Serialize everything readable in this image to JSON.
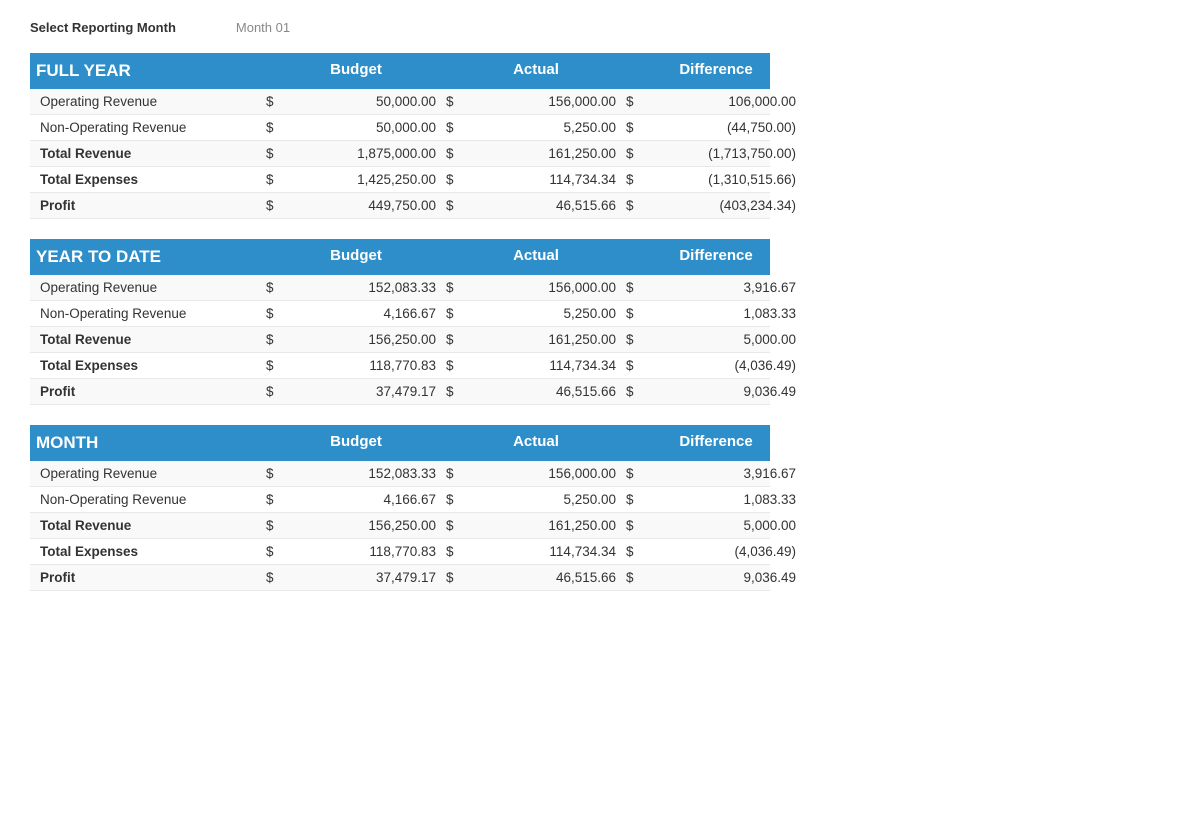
{
  "reporting": {
    "label": "Select Reporting Month",
    "value": "Month 01"
  },
  "sections": [
    {
      "id": "full-year",
      "title": "FULL YEAR",
      "columns": [
        "Budget",
        "Actual",
        "Difference"
      ],
      "rows": [
        {
          "label": " Operating Revenue",
          "bold": false,
          "budget_sign": "$",
          "budget": "50,000.00",
          "actual_sign": "$",
          "actual": "156,000.00",
          "diff_sign": "$",
          "diff": "106,000.00"
        },
        {
          "label": " Non-Operating Revenue",
          "bold": false,
          "budget_sign": "$",
          "budget": "50,000.00",
          "actual_sign": "$",
          "actual": "5,250.00",
          "diff_sign": "$",
          "diff": "(44,750.00)"
        },
        {
          "label": "Total Revenue",
          "bold": true,
          "budget_sign": "$",
          "budget": "1,875,000.00",
          "actual_sign": "$",
          "actual": "161,250.00",
          "diff_sign": "$",
          "diff": "(1,713,750.00)"
        },
        {
          "label": "Total Expenses",
          "bold": true,
          "budget_sign": "$",
          "budget": "1,425,250.00",
          "actual_sign": "$",
          "actual": "114,734.34",
          "diff_sign": "$",
          "diff": "(1,310,515.66)"
        },
        {
          "label": "Profit",
          "bold": true,
          "budget_sign": "$",
          "budget": "449,750.00",
          "actual_sign": "$",
          "actual": "46,515.66",
          "diff_sign": "$",
          "diff": "(403,234.34)"
        }
      ]
    },
    {
      "id": "year-to-date",
      "title": "YEAR TO DATE",
      "columns": [
        "Budget",
        "Actual",
        "Difference"
      ],
      "rows": [
        {
          "label": " Operating Revenue",
          "bold": false,
          "budget_sign": "$",
          "budget": "152,083.33",
          "actual_sign": "$",
          "actual": "156,000.00",
          "diff_sign": "$",
          "diff": "3,916.67"
        },
        {
          "label": " Non-Operating Revenue",
          "bold": false,
          "budget_sign": "$",
          "budget": "4,166.67",
          "actual_sign": "$",
          "actual": "5,250.00",
          "diff_sign": "$",
          "diff": "1,083.33"
        },
        {
          "label": "Total Revenue",
          "bold": true,
          "budget_sign": "$",
          "budget": "156,250.00",
          "actual_sign": "$",
          "actual": "161,250.00",
          "diff_sign": "$",
          "diff": "5,000.00"
        },
        {
          "label": "Total Expenses",
          "bold": true,
          "budget_sign": "$",
          "budget": "118,770.83",
          "actual_sign": "$",
          "actual": "114,734.34",
          "diff_sign": "$",
          "diff": "(4,036.49)"
        },
        {
          "label": "Profit",
          "bold": true,
          "budget_sign": "$",
          "budget": "37,479.17",
          "actual_sign": "$",
          "actual": "46,515.66",
          "diff_sign": "$",
          "diff": "9,036.49"
        }
      ]
    },
    {
      "id": "month",
      "title": "MONTH",
      "columns": [
        "Budget",
        "Actual",
        "Difference"
      ],
      "rows": [
        {
          "label": " Operating Revenue",
          "bold": false,
          "budget_sign": "$",
          "budget": "152,083.33",
          "actual_sign": "$",
          "actual": "156,000.00",
          "diff_sign": "$",
          "diff": "3,916.67"
        },
        {
          "label": " Non-Operating Revenue",
          "bold": false,
          "budget_sign": "$",
          "budget": "4,166.67",
          "actual_sign": "$",
          "actual": "5,250.00",
          "diff_sign": "$",
          "diff": "1,083.33"
        },
        {
          "label": "Total Revenue",
          "bold": true,
          "budget_sign": "$",
          "budget": "156,250.00",
          "actual_sign": "$",
          "actual": "161,250.00",
          "diff_sign": "$",
          "diff": "5,000.00"
        },
        {
          "label": "Total Expenses",
          "bold": true,
          "budget_sign": "$",
          "budget": "118,770.83",
          "actual_sign": "$",
          "actual": "114,734.34",
          "diff_sign": "$",
          "diff": "(4,036.49)"
        },
        {
          "label": "Profit",
          "bold": true,
          "budget_sign": "$",
          "budget": "37,479.17",
          "actual_sign": "$",
          "actual": "46,515.66",
          "diff_sign": "$",
          "diff": "9,036.49"
        }
      ]
    }
  ]
}
